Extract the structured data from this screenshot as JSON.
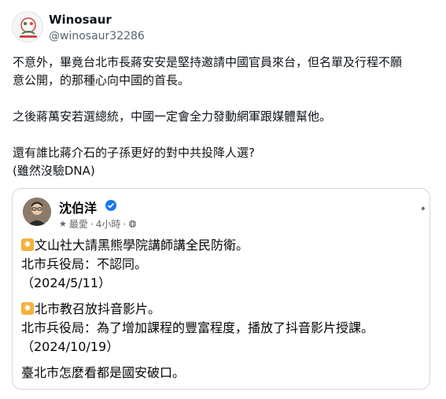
{
  "post": {
    "author_name": "Winosaur",
    "author_handle": "@winosaur32286",
    "paragraphs": [
      [
        "不意外，畢竟台北市長蔣安安是堅持邀請中國官員來台，但名單及行程不願",
        "意公開，的那種心向中國的首長。"
      ],
      [
        "之後蔣萬安若選總統，中國一定會全力發動網軍跟媒體幫他。"
      ],
      [
        "還有誰比蔣介石的子孫更好的對中共投降人選?",
        "(雖然沒驗DNA)"
      ]
    ]
  },
  "quote": {
    "author_name": "沈伯洋",
    "meta_favorite": "最愛",
    "meta_dot": "·",
    "meta_time": "4小時",
    "meta_dot2": "·",
    "more_glyph": "•",
    "lines": {
      "item1": "文山社大請黑熊學院講師講全民防衛。",
      "item1_response": "北市兵役局：不認同。",
      "item1_date": "（2024/5/11）",
      "item2": "北市教召放抖音影片。",
      "item2_response": "北市兵役局：為了增加課程的豐富程度，播放了抖音影片授課。",
      "item2_date": "（2024/10/19）",
      "conclusion": "臺北市怎麼看都是國安破口。"
    }
  },
  "icons": {
    "avatar": "avatar-logo-icon",
    "verified": "verified-badge-icon",
    "star": "star-icon",
    "globe": "globe-icon",
    "item_badge": "star-badge-icon"
  },
  "colors": {
    "verified_blue": "#1877f2",
    "badge_orange": "#f4b23e",
    "handle_gray": "#536471"
  }
}
